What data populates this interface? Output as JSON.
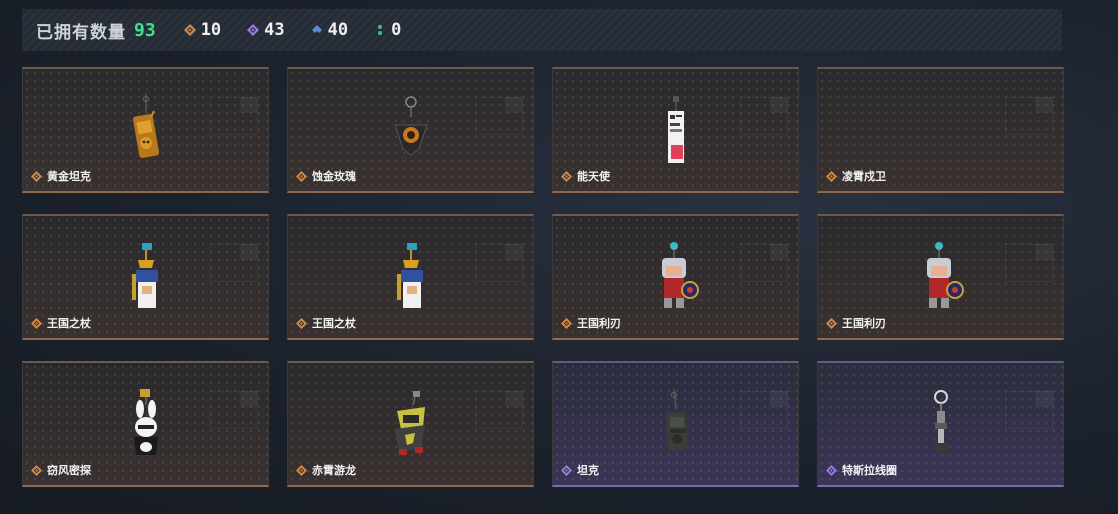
{
  "summary": {
    "owned_label": "已拥有数量",
    "owned_count": "93",
    "stats": [
      {
        "icon": "orange-diamond-icon",
        "color": "#d08a4a",
        "value": "10"
      },
      {
        "icon": "purple-diamond-icon",
        "color": "#9a7ae0",
        "value": "43"
      },
      {
        "icon": "blue-diamond-icon",
        "color": "#5a8ad8",
        "value": "40"
      },
      {
        "icon": "green-dots-icon",
        "color": "#3ec08a",
        "value": "0"
      }
    ]
  },
  "items": [
    {
      "name": "黄金坦克",
      "rarity": "orange",
      "art": "golden-tank-pendant"
    },
    {
      "name": "蚀金玫瑰",
      "rarity": "orange",
      "art": "rose-pendant"
    },
    {
      "name": "能天使",
      "rarity": "orange",
      "art": "exusiai-pendant"
    },
    {
      "name": "凌霄戍卫",
      "rarity": "orange",
      "art": "empty"
    },
    {
      "name": "王国之杖",
      "rarity": "orange",
      "art": "kingdom-scepter-pendant"
    },
    {
      "name": "王国之杖",
      "rarity": "orange",
      "art": "kingdom-scepter-pendant"
    },
    {
      "name": "王国利刃",
      "rarity": "orange",
      "art": "kingdom-blade-knight"
    },
    {
      "name": "王国利刃",
      "rarity": "orange",
      "art": "kingdom-blade-knight"
    },
    {
      "name": "窃风密探",
      "rarity": "orange",
      "art": "bunny-spy-pendant"
    },
    {
      "name": "赤霄游龙",
      "rarity": "orange",
      "art": "dragon-pendant"
    },
    {
      "name": "坦克",
      "rarity": "purple",
      "art": "tank-pendant"
    },
    {
      "name": "特斯拉线圈",
      "rarity": "purple",
      "art": "tesla-coil-pendant"
    }
  ],
  "colors": {
    "orange": "#d08a4a",
    "purple": "#9a7ae0"
  }
}
